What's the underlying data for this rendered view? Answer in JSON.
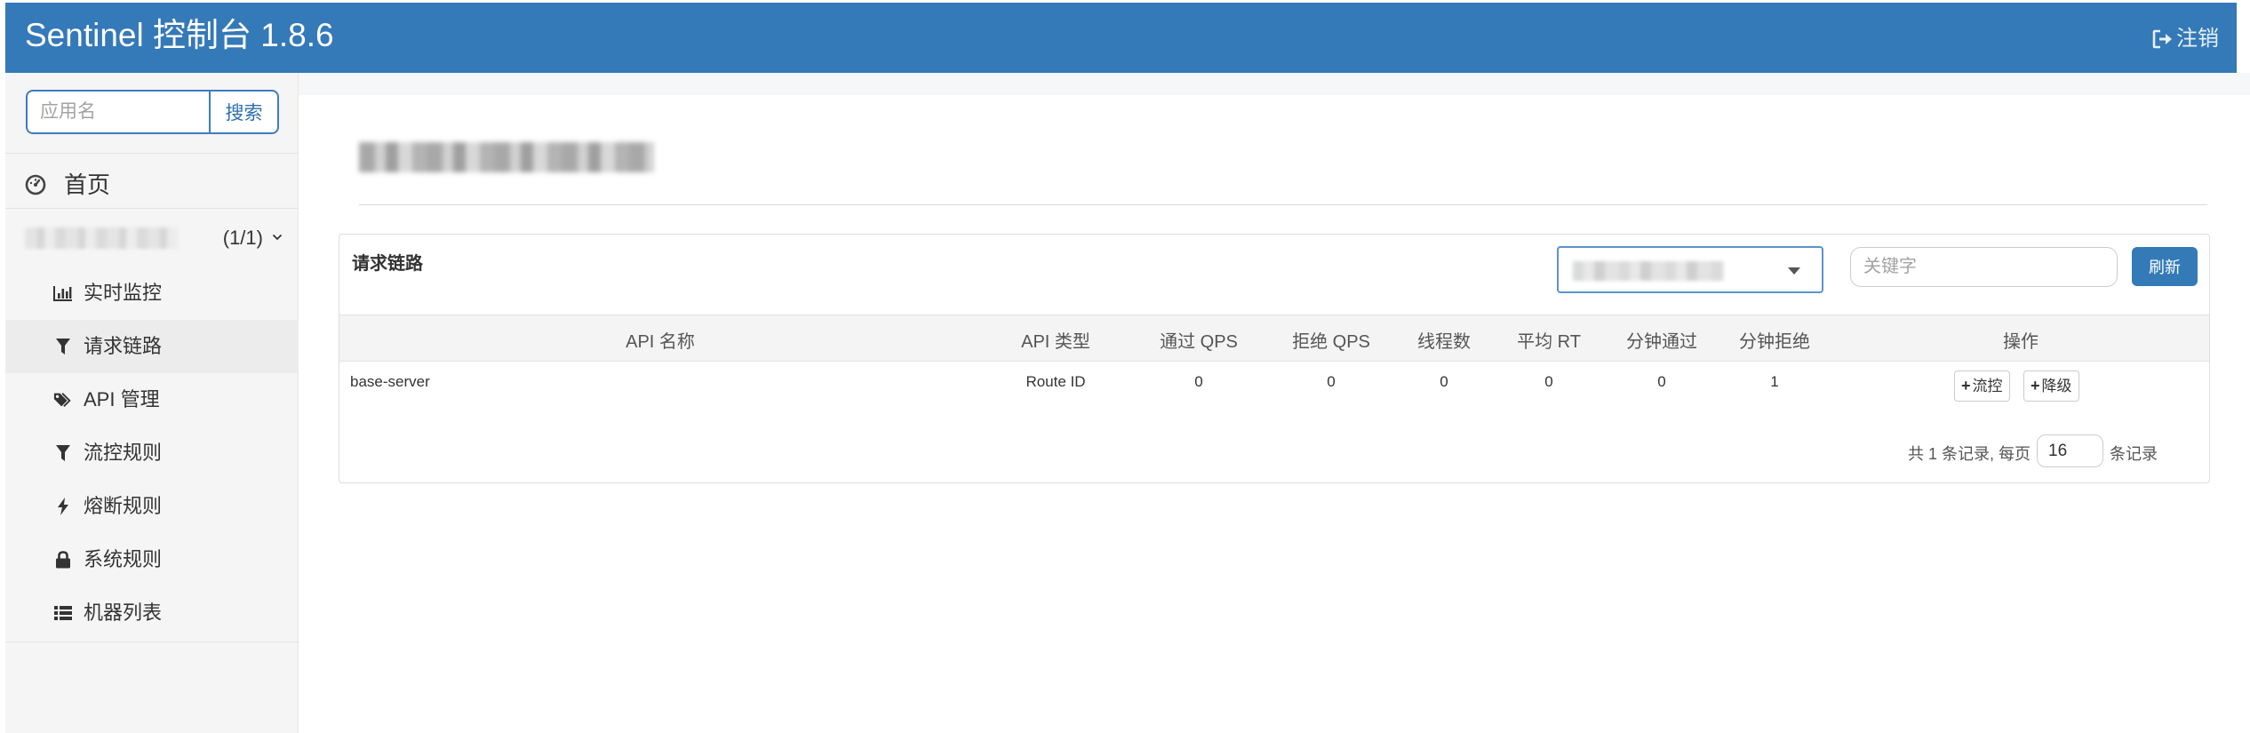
{
  "header": {
    "title": "Sentinel 控制台 1.8.6",
    "logout_label": "注销",
    "logout_icon": "sign-out-icon",
    "background_color": "#3479b8"
  },
  "sidebar": {
    "search": {
      "placeholder": "应用名",
      "button_label": "搜索"
    },
    "home": {
      "label": "首页",
      "icon": "dashboard-icon"
    },
    "app": {
      "count": "(1/1)",
      "expanded": true
    },
    "items": [
      {
        "label": "实时监控",
        "icon": "bar-chart-icon",
        "active": false
      },
      {
        "label": "请求链路",
        "icon": "filter-icon",
        "active": true
      },
      {
        "label": "API 管理",
        "icon": "tags-icon",
        "active": false
      },
      {
        "label": "流控规则",
        "icon": "filter-icon",
        "active": false
      },
      {
        "label": "熔断规则",
        "icon": "flash-icon",
        "active": false
      },
      {
        "label": "系统规则",
        "icon": "lock-icon",
        "active": false
      },
      {
        "label": "机器列表",
        "icon": "list-icon",
        "active": false
      }
    ]
  },
  "panel": {
    "title": "请求链路",
    "keyword_placeholder": "关键字",
    "refresh_label": "刷新",
    "accent_color": "#337ab7"
  },
  "table": {
    "headers": [
      "API 名称",
      "API 类型",
      "通过 QPS",
      "拒绝 QPS",
      "线程数",
      "平均 RT",
      "分钟通过",
      "分钟拒绝",
      "操作"
    ],
    "rows": [
      {
        "api_name": "base-server",
        "api_type": "Route ID",
        "pass_qps": "0",
        "block_qps": "0",
        "threads": "0",
        "avg_rt": "0",
        "minute_pass": "0",
        "minute_block": "1",
        "actions": [
          "流控",
          "降级"
        ]
      }
    ]
  },
  "pagination": {
    "summary": "共 1 条记录, 每页",
    "page_size": "16",
    "suffix": "条记录"
  }
}
